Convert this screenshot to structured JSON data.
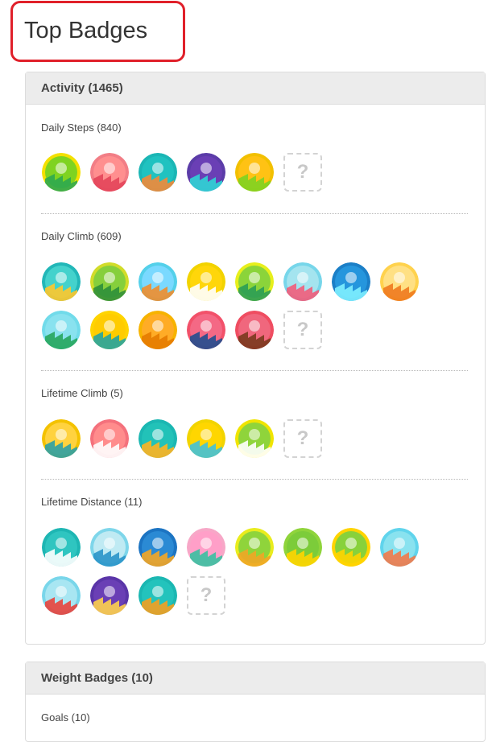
{
  "page": {
    "title": "Top Badges"
  },
  "activity": {
    "header": "Activity (1465)",
    "sections": [
      {
        "title": "Daily Steps (840)",
        "badges": [
          {
            "name": "daily-steps-green-shoe-icon",
            "ring": "#f4e000",
            "bg": "#7fd321",
            "accent": "#2ea84f"
          },
          {
            "name": "daily-steps-red-shoe-icon",
            "ring": "#f27e86",
            "bg": "#ff8f8f",
            "accent": "#e4455a"
          },
          {
            "name": "daily-steps-teal-shoe-icon",
            "ring": "#1bb6b5",
            "bg": "#20c2c0",
            "accent": "#f28a38"
          },
          {
            "name": "daily-steps-purple-shoe-icon",
            "ring": "#5b3ca8",
            "bg": "#6a3fb5",
            "accent": "#2fd5d5"
          },
          {
            "name": "daily-steps-gold-shoe-icon",
            "ring": "#f2c000",
            "bg": "#ffc214",
            "accent": "#7fd321"
          }
        ],
        "locked": "?"
      },
      {
        "title": "Daily Climb (609)",
        "badges": [
          {
            "name": "daily-climb-hill-icon",
            "ring": "#22b7b8",
            "bg": "#44d2cc",
            "accent": "#ffc82c"
          },
          {
            "name": "daily-climb-forest-icon",
            "ring": "#d2dc2a",
            "bg": "#86cf3c",
            "accent": "#2d8f3a"
          },
          {
            "name": "daily-climb-lighthouse-icon",
            "ring": "#54d0ea",
            "bg": "#7ad9ff",
            "accent": "#f08d2d"
          },
          {
            "name": "daily-climb-ferris-wheel-icon",
            "ring": "#f2d300",
            "bg": "#ffd60a",
            "accent": "#ffffff"
          },
          {
            "name": "daily-climb-skyscraper-icon",
            "ring": "#e7ef1c",
            "bg": "#8bd43a",
            "accent": "#2a9d55"
          },
          {
            "name": "daily-climb-rollercoaster-icon",
            "ring": "#77d6ea",
            "bg": "#a4e4ef",
            "accent": "#f25c7a"
          },
          {
            "name": "daily-climb-city-icon",
            "ring": "#1b7fc7",
            "bg": "#2596dd",
            "accent": "#7ff0ff"
          },
          {
            "name": "daily-climb-bridge-icon",
            "ring": "#ffd24d",
            "bg": "#ffe084",
            "accent": "#f07a1f"
          },
          {
            "name": "daily-climb-castle-icon",
            "ring": "#71dbea",
            "bg": "#89e2ef",
            "accent": "#27a65d"
          },
          {
            "name": "daily-climb-waterfall-icon",
            "ring": "#ffd400",
            "bg": "#ffcc00",
            "accent": "#26a4a0"
          },
          {
            "name": "daily-climb-canyon-icon",
            "ring": "#f7b300",
            "bg": "#ffac26",
            "accent": "#e67b00"
          },
          {
            "name": "daily-climb-volcano-icon",
            "ring": "#f2516a",
            "bg": "#f46985",
            "accent": "#214e8f"
          },
          {
            "name": "daily-climb-mountain-icon",
            "ring": "#ef4d61",
            "bg": "#f0677d",
            "accent": "#7a3a1e"
          }
        ],
        "locked": "?"
      },
      {
        "title": "Lifetime Climb (5)",
        "badges": [
          {
            "name": "lifetime-climb-helicopter-icon",
            "ring": "#f4c200",
            "bg": "#ffd23f",
            "accent": "#2ea0a5"
          },
          {
            "name": "lifetime-climb-skydiver-icon",
            "ring": "#f4717c",
            "bg": "#ff8c8c",
            "accent": "#ffffff"
          },
          {
            "name": "lifetime-climb-hot-air-balloon-icon",
            "ring": "#1bb7b2",
            "bg": "#22c2b8",
            "accent": "#ffb420"
          },
          {
            "name": "lifetime-climb-airplane-icon",
            "ring": "#f2d400",
            "bg": "#ffd600",
            "accent": "#43c1d8"
          },
          {
            "name": "lifetime-climb-cloud-icon",
            "ring": "#f0e400",
            "bg": "#8fd43b",
            "accent": "#ffffff"
          }
        ],
        "locked": "?"
      },
      {
        "title": "Lifetime Distance (11)",
        "badges": [
          {
            "name": "lifetime-distance-greek-temple-icon",
            "ring": "#1eb6b3",
            "bg": "#2fc5c0",
            "accent": "#ffffff"
          },
          {
            "name": "lifetime-distance-sea-icon",
            "ring": "#7ed6ea",
            "bg": "#bfeaf3",
            "accent": "#2a95c9"
          },
          {
            "name": "lifetime-distance-london-icon",
            "ring": "#1c74c2",
            "bg": "#2b8ad4",
            "accent": "#f5a623"
          },
          {
            "name": "lifetime-distance-tropics-icon",
            "ring": "#f7a7c7",
            "bg": "#ff9fc8",
            "accent": "#3ac0a1"
          },
          {
            "name": "lifetime-distance-giraffe-icon",
            "ring": "#e9ec1e",
            "bg": "#8fd43b",
            "accent": "#f0a626"
          },
          {
            "name": "lifetime-distance-palace-icon",
            "ring": "#8fd43b",
            "bg": "#7ccc3a",
            "accent": "#ffd500"
          },
          {
            "name": "lifetime-distance-countryside-icon",
            "ring": "#ffd400",
            "bg": "#88d13b",
            "accent": "#ffd400"
          },
          {
            "name": "lifetime-distance-reef-icon",
            "ring": "#60d4ec",
            "bg": "#89e2ef",
            "accent": "#f27a4a"
          },
          {
            "name": "lifetime-distance-pagoda-icon",
            "ring": "#79d6ea",
            "bg": "#a8e6f2",
            "accent": "#e8423c"
          },
          {
            "name": "lifetime-distance-taj-mahal-icon",
            "ring": "#5a35a8",
            "bg": "#6a3fb5",
            "accent": "#ffd24d"
          },
          {
            "name": "lifetime-distance-butterfly-icon",
            "ring": "#1bb7b2",
            "bg": "#23c3bc",
            "accent": "#f4a01f"
          }
        ],
        "locked": "?"
      }
    ]
  },
  "weight": {
    "header": "Weight Badges (10)",
    "sections": [
      {
        "title": "Goals (10)"
      }
    ]
  }
}
